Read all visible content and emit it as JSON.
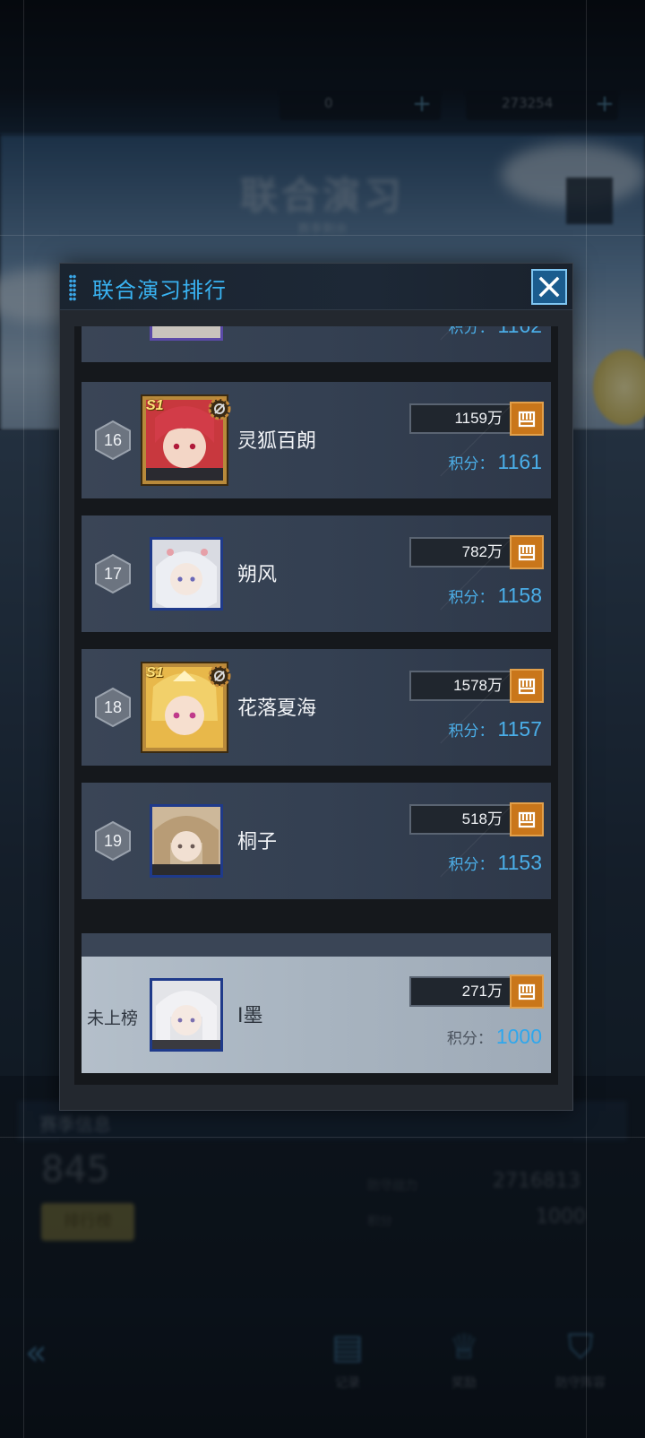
{
  "background": {
    "resource_1_value": "0",
    "resource_2_value": "273254",
    "mode_title": "联合演习",
    "mode_subtitle": "赛季剩余",
    "info_title": "赛季信息",
    "my_rank_big": "845",
    "leaderboard_button": "排行榜",
    "stat_1_label": "防守战力",
    "stat_1_value": "2716813",
    "stat_2_label": "积分",
    "stat_2_value": "1000",
    "nav": [
      {
        "label": "记录",
        "icon": "record-icon"
      },
      {
        "label": "奖励",
        "icon": "trophy-icon"
      },
      {
        "label": "防守阵容",
        "icon": "shield-icon"
      }
    ]
  },
  "modal": {
    "title": "联合演习排行",
    "close_icon": "close-icon"
  },
  "score_label": "积分：",
  "top_partial_row": {
    "score": "1162"
  },
  "rows": [
    {
      "rank": "16",
      "name": "灵狐百朗",
      "power": "1159万",
      "score": "1161",
      "frame": "gold",
      "badge": "S1"
    },
    {
      "rank": "17",
      "name": "朔风",
      "power": "782万",
      "score": "1158",
      "frame": "blue",
      "badge": ""
    },
    {
      "rank": "18",
      "name": "花落夏海",
      "power": "1578万",
      "score": "1157",
      "frame": "gold",
      "badge": "S1"
    },
    {
      "rank": "19",
      "name": "桐子",
      "power": "518万",
      "score": "1153",
      "frame": "blue",
      "badge": ""
    }
  ],
  "my_row": {
    "rank_text": "未上榜",
    "name": "I墨",
    "power": "271万",
    "score": "1000"
  },
  "colors": {
    "accent_blue": "#39b3f2",
    "score_blue": "#4aaee8",
    "power_orange": "#c9761a",
    "gold_frame": "#b88a3b"
  }
}
